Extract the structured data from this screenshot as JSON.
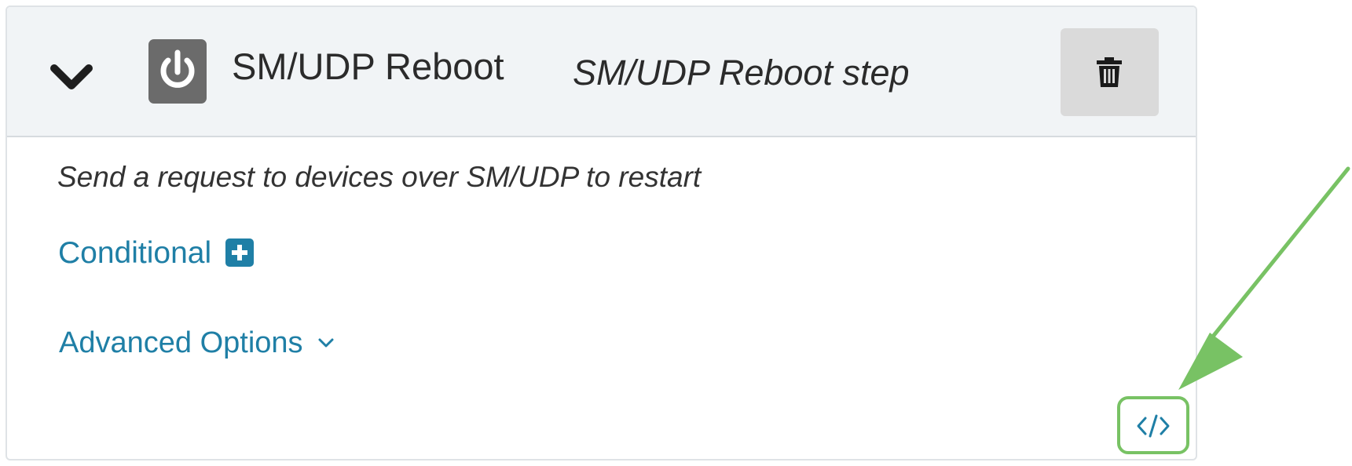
{
  "step": {
    "name": "SM/UDP Reboot",
    "label": "SM/UDP Reboot step",
    "description": "Send a request to devices over SM/UDP to restart",
    "icon": "power-icon"
  },
  "header": {
    "collapse_icon": "chevron-down-icon",
    "delete_icon": "trash-icon"
  },
  "conditional": {
    "label": "Conditional",
    "icon": "plus-square-icon"
  },
  "advanced_options": {
    "label": "Advanced Options",
    "icon": "chevron-down-icon"
  },
  "code_view": {
    "icon": "code-icon"
  },
  "colors": {
    "header_bg": "#f1f4f6",
    "link": "#1f7fa6",
    "step_icon_bg": "#6b6b6b",
    "delete_bg": "#dadada",
    "annotation": "#78c264"
  }
}
